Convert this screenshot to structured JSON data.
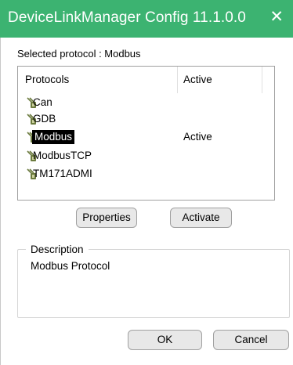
{
  "window": {
    "title": "DeviceLinkManager Config 11.1.0.0",
    "close_glyph": "✕",
    "title_color": "#3cb371"
  },
  "selected_protocol_label": "Selected protocol : Modbus",
  "table": {
    "headers": [
      "Protocols",
      "Active"
    ],
    "rows": [
      {
        "name": "Can",
        "active": "",
        "icon": "plug-icon"
      },
      {
        "name": "GDB",
        "active": "",
        "icon": "plug-icon"
      },
      {
        "name": "Modbus",
        "active": "Active",
        "icon": "plug-icon",
        "selected": true
      },
      {
        "name": "ModbusTCP",
        "active": "",
        "icon": "plug-icon"
      },
      {
        "name": "TM171ADMI",
        "active": "",
        "icon": "plug-icon"
      }
    ]
  },
  "buttons": {
    "properties": "Properties",
    "activate": "Activate",
    "ok": "OK",
    "cancel": "Cancel"
  },
  "description": {
    "legend": "Description",
    "text": "Modbus Protocol"
  }
}
